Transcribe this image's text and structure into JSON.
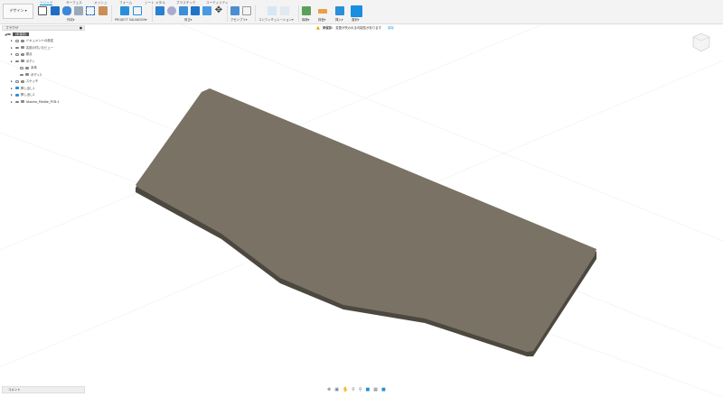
{
  "toolbar": {
    "workspace": "デザイン ▾",
    "tabs": [
      "ソリッド",
      "サーフェス",
      "メッシュ",
      "フォーム",
      "シート メタル",
      "プラスチック",
      "ユーティリティ"
    ],
    "groups": [
      "作成▾",
      "PROJECT SALVADOR▾",
      "修正▾",
      "アセンブリ▾",
      "コンフィギュレーション▾",
      "構築▾",
      "検査▾",
      "挿入▾",
      "選択▾"
    ]
  },
  "browser": {
    "title": "ブラウザ",
    "root": "(未保存)",
    "items": [
      {
        "label": "ドキュメントの設定",
        "indent": 1
      },
      {
        "label": "名前の付いたビュー",
        "indent": 1
      },
      {
        "label": "原点",
        "indent": 1
      },
      {
        "label": "ボディ",
        "indent": 1
      },
      {
        "label": "本体",
        "indent": 2
      },
      {
        "label": "ボディ2",
        "indent": 2
      },
      {
        "label": "スケッチ",
        "indent": 1
      },
      {
        "label": "押し出し1",
        "indent": 1
      },
      {
        "label": "押し出し2",
        "indent": 1
      },
      {
        "label": "Akasha_Middle_PCB:1",
        "indent": 1
      }
    ]
  },
  "warning": {
    "label": "未保存:",
    "message": "変更が失われる可能性があります",
    "action": "保存"
  },
  "comments": {
    "label": "コメント"
  },
  "colors": {
    "accent": "#0696d7",
    "plate": "#7a7265",
    "plate_edge": "#4a453d"
  }
}
